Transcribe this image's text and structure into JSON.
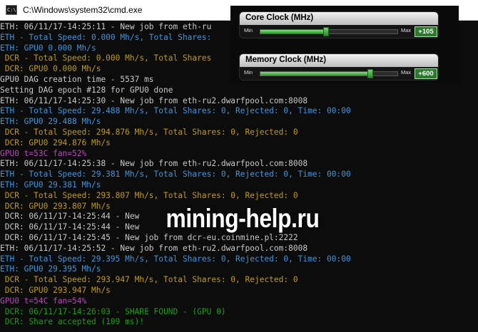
{
  "window": {
    "title": "C:\\Windows\\system32\\cmd.exe",
    "icon": "cmd-icon",
    "icon_text": "C:\\"
  },
  "colors": {
    "background": "#0c0c0c",
    "white": "#c8c8c8",
    "cyan": "#3a96dd",
    "yellow": "#c19c00",
    "green": "#13a10e",
    "magenta": "#b845b8",
    "slider_green": "#2c7a2c"
  },
  "console": {
    "lines": [
      {
        "text": "ETH: 06/11/17-14:25:11 - New job from eth-ru",
        "color": "white"
      },
      {
        "text": "ETH - Total Speed: 0.000 Mh/s, Total Shares:",
        "color": "cyan"
      },
      {
        "text": "ETH: GPU0 0.000 Mh/s",
        "color": "cyan"
      },
      {
        "text": " DCR - Total Speed: 0.000 Mh/s, Total Shares",
        "color": "yellow"
      },
      {
        "text": " DCR: GPU0 0.000 Mh/s",
        "color": "yellow"
      },
      {
        "text": "GPU0 DAG creation time - 5537 ms",
        "color": "white"
      },
      {
        "text": "Setting DAG epoch #128 for GPU0 done",
        "color": "white"
      },
      {
        "text": "ETH: 06/11/17-14:25:30 - New job from eth-ru2.dwarfpool.com:8008",
        "color": "white"
      },
      {
        "text": "ETH - Total Speed: 29.488 Mh/s, Total Shares: 0, Rejected: 0, Time: 00:00",
        "color": "cyan"
      },
      {
        "text": "ETH: GPU0 29.488 Mh/s",
        "color": "cyan"
      },
      {
        "text": " DCR - Total Speed: 294.876 Mh/s, Total Shares: 0, Rejected: 0",
        "color": "yellow"
      },
      {
        "text": " DCR: GPU0 294.876 Mh/s",
        "color": "yellow"
      },
      {
        "text": "GPU0 t=53C fan=52%",
        "color": "magenta"
      },
      {
        "text": "ETH: 06/11/17-14:25:38 - New job from eth-ru2.dwarfpool.com:8008",
        "color": "white"
      },
      {
        "text": "ETH - Total Speed: 29.381 Mh/s, Total Shares: 0, Rejected: 0, Time: 00:00",
        "color": "cyan"
      },
      {
        "text": "ETH: GPU0 29.381 Mh/s",
        "color": "cyan"
      },
      {
        "text": " DCR - Total Speed: 293.807 Mh/s, Total Shares: 0, Rejected: 0",
        "color": "yellow"
      },
      {
        "text": " DCR: GPU0 293.807 Mh/s",
        "color": "yellow"
      },
      {
        "text": " DCR: 06/11/17-14:25:44 - New",
        "color": "white"
      },
      {
        "text": " DCR: 06/11/17-14:25:44 - New",
        "color": "white"
      },
      {
        "text": " DCR: 06/11/17-14:25:45 - New job from dcr-eu.coinmine.pl:2222",
        "color": "white"
      },
      {
        "text": "ETH: 06/11/17-14:25:52 - New job from eth-ru2.dwarfpool.com:8008",
        "color": "white"
      },
      {
        "text": "ETH - Total Speed: 29.395 Mh/s, Total Shares: 0, Rejected: 0, Time: 00:00",
        "color": "cyan"
      },
      {
        "text": "ETH: GPU0 29.395 Mh/s",
        "color": "cyan"
      },
      {
        "text": " DCR - Total Speed: 293.947 Mh/s, Total Shares: 0, Rejected: 0",
        "color": "yellow"
      },
      {
        "text": " DCR: GPU0 293.947 Mh/s",
        "color": "yellow"
      },
      {
        "text": "GPU0 t=54C fan=54%",
        "color": "magenta"
      },
      {
        "text": " DCR: 06/11/17-14:26:03 - SHARE FOUND - (GPU 0)",
        "color": "green"
      },
      {
        "text": " DCR: Share accepted (109 ms)!",
        "color": "green"
      }
    ]
  },
  "overclock": {
    "core": {
      "title": "Core Clock (MHz)",
      "min": "Min",
      "max": "Max",
      "value": "+105",
      "level": 0.48
    },
    "memory": {
      "title": "Memory Clock (MHz)",
      "min": "Min",
      "max": "Max",
      "value": "+600",
      "level": 0.8
    }
  },
  "watermark": {
    "text": "mining-help.ru"
  }
}
